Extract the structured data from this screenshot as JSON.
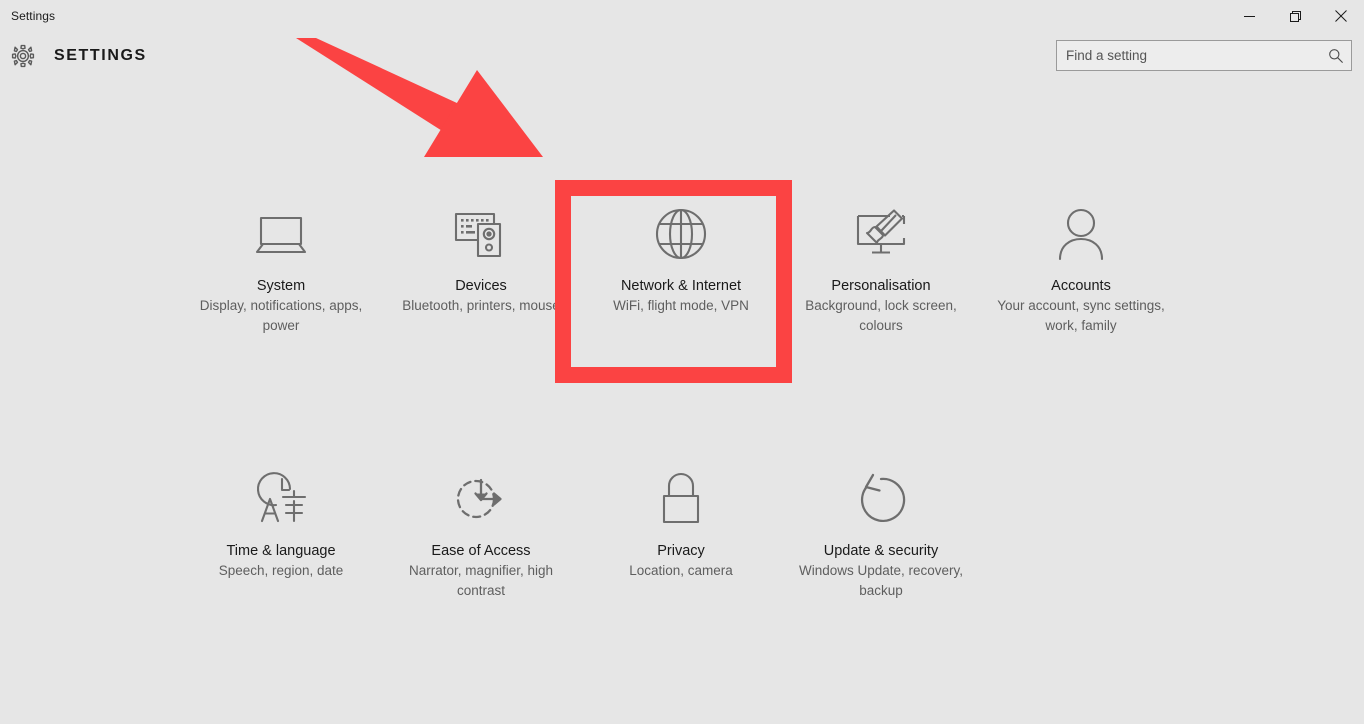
{
  "window": {
    "caption": "Settings",
    "controls": [
      {
        "name": "minimize",
        "label": "Minimise"
      },
      {
        "name": "maximize",
        "label": "Restore"
      },
      {
        "name": "close",
        "label": "Close"
      }
    ]
  },
  "header": {
    "title": "SETTINGS",
    "icon": "gear-icon"
  },
  "search": {
    "placeholder": "Find a setting",
    "value": "",
    "icon": "search-icon"
  },
  "tiles": [
    {
      "id": "system",
      "icon": "laptop-icon",
      "title": "System",
      "subtitle": "Display, notifications, apps, power"
    },
    {
      "id": "devices",
      "icon": "devices-icon",
      "title": "Devices",
      "subtitle": "Bluetooth, printers, mouse"
    },
    {
      "id": "network-internet",
      "icon": "globe-icon",
      "title": "Network & Internet",
      "subtitle": "WiFi, flight mode, VPN",
      "highlighted": true
    },
    {
      "id": "personalisation",
      "icon": "monitor-brush-icon",
      "title": "Personalisation",
      "subtitle": "Background, lock screen, colours"
    },
    {
      "id": "accounts",
      "icon": "person-icon",
      "title": "Accounts",
      "subtitle": "Your account, sync settings, work, family"
    },
    {
      "id": "time-language",
      "icon": "clock-language-icon",
      "title": "Time & language",
      "subtitle": "Speech, region, date"
    },
    {
      "id": "ease-of-access",
      "icon": "ease-of-access-icon",
      "title": "Ease of Access",
      "subtitle": "Narrator, magnifier, high contrast"
    },
    {
      "id": "privacy",
      "icon": "lock-icon",
      "title": "Privacy",
      "subtitle": "Location, camera"
    },
    {
      "id": "update-security",
      "icon": "refresh-icon",
      "title": "Update & security",
      "subtitle": "Windows Update, recovery, backup"
    }
  ],
  "annotations": {
    "accent_colour": "#fb4343",
    "arrow": {
      "name": "pointer-arrow",
      "points_to": "network-internet"
    },
    "highlight": {
      "name": "highlight-box",
      "targets": "network-internet"
    }
  },
  "colours": {
    "background": "#e6e6e6",
    "icon_grey": "#6e6e6e",
    "title_text": "#1a1a1a",
    "subtitle_text": "#5e5e5e",
    "accent_red": "#fb4343"
  }
}
